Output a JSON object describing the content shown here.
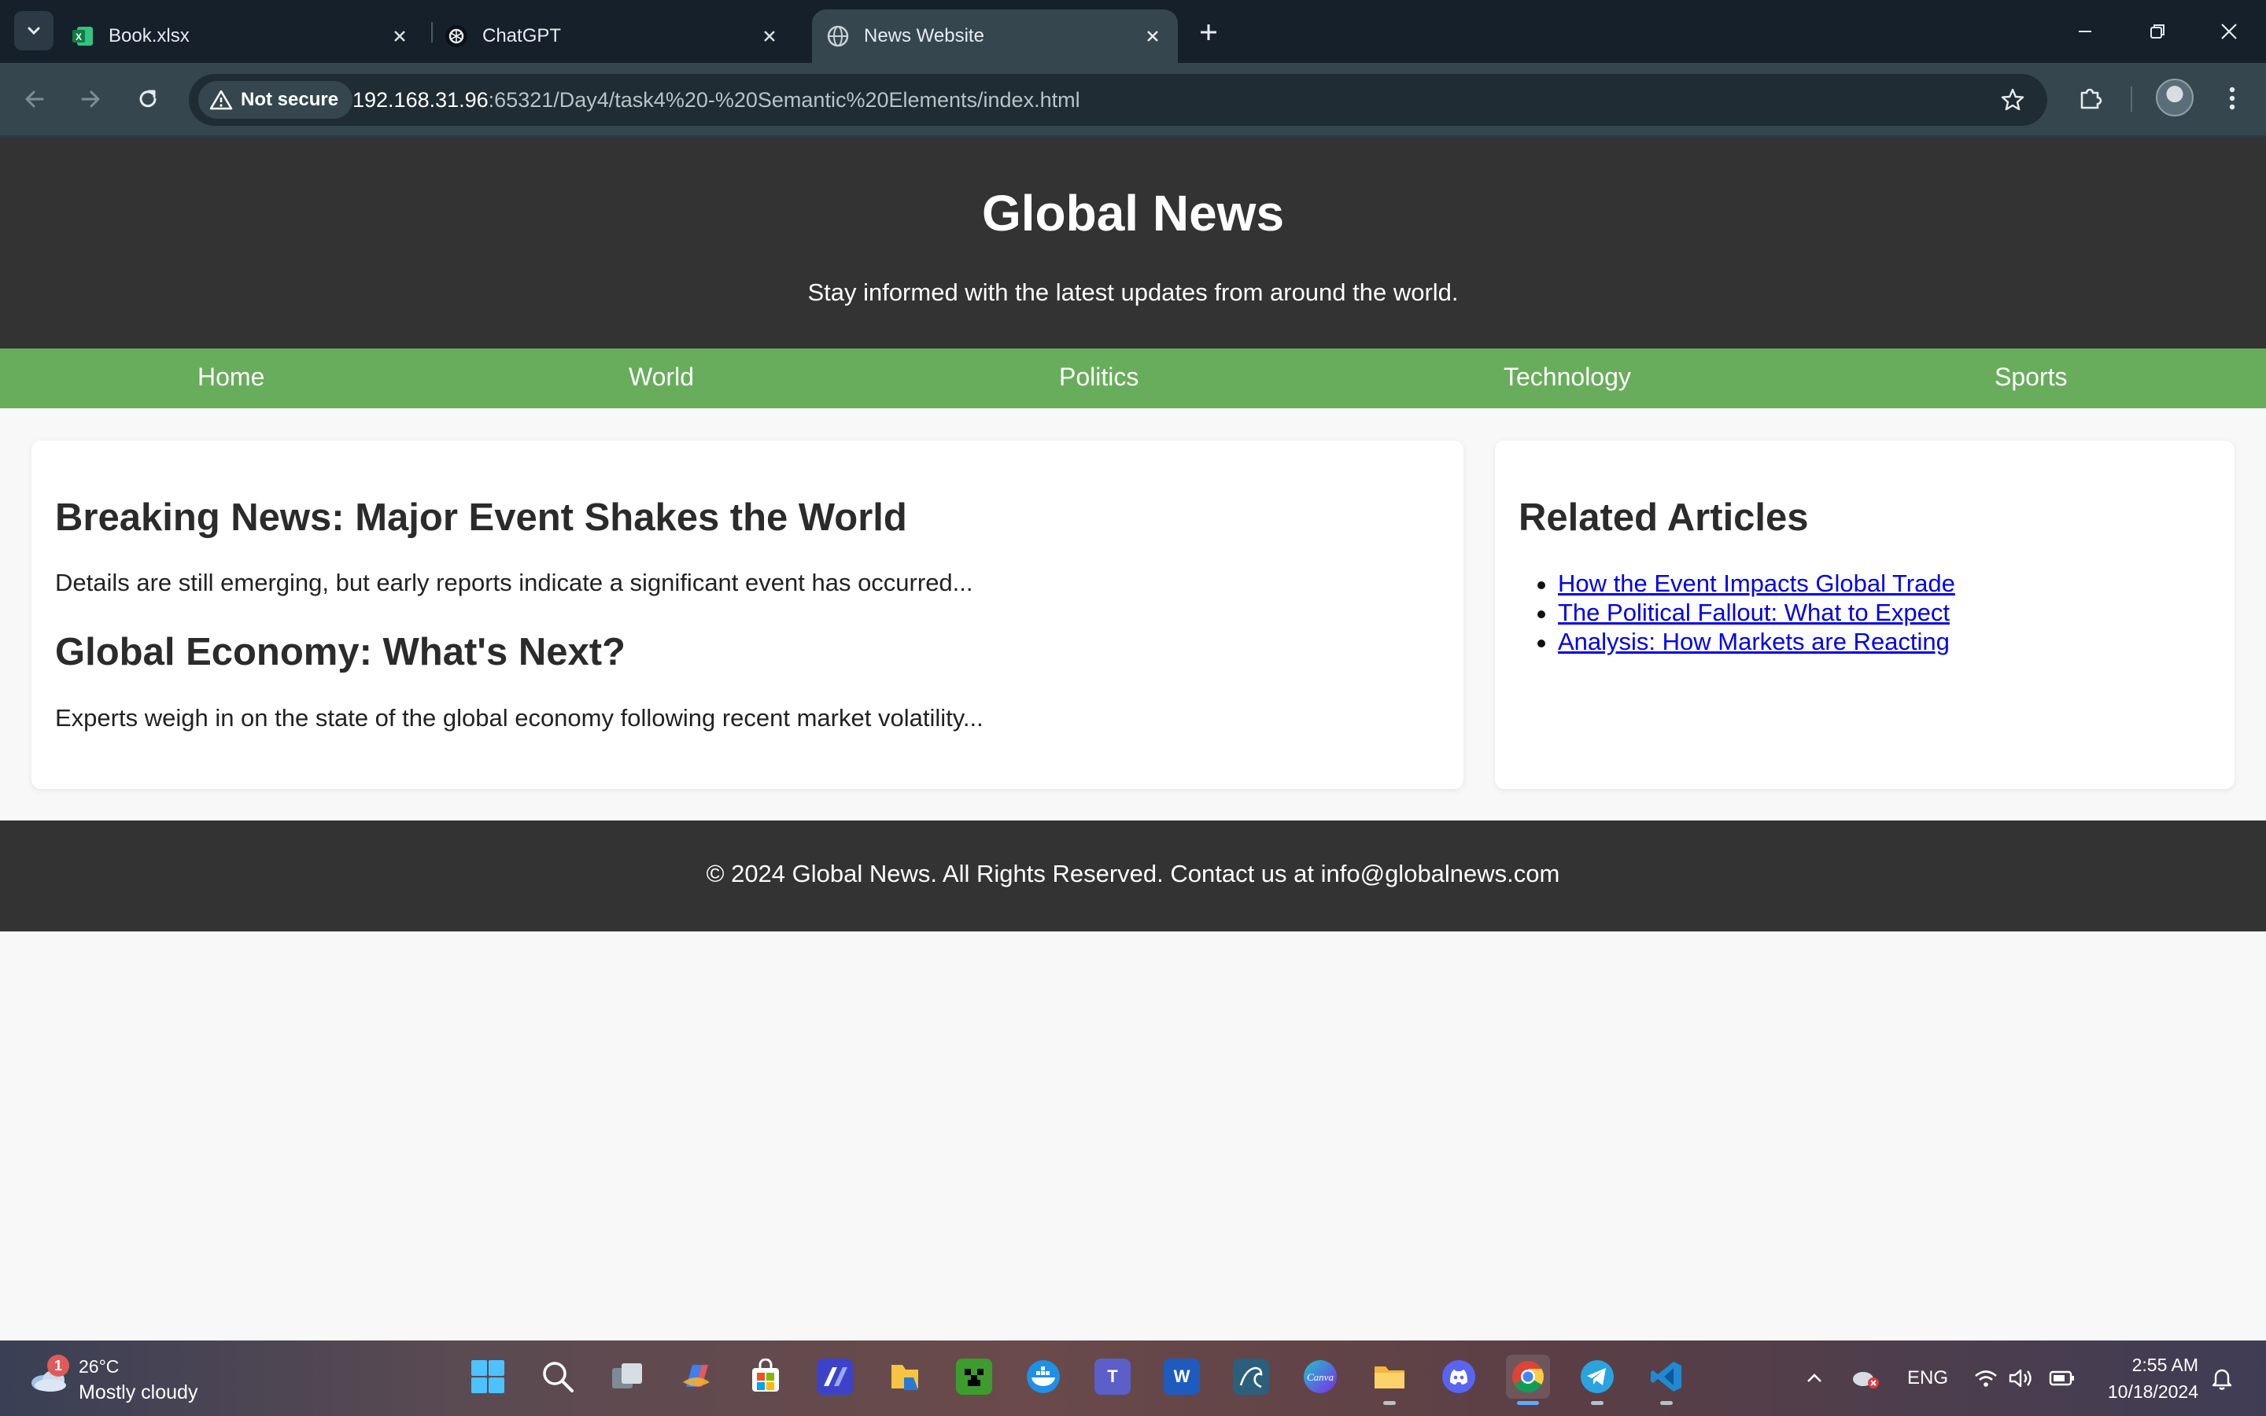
{
  "browser": {
    "tabs": [
      {
        "title": "Book.xlsx",
        "icon": "excel-icon",
        "active": false
      },
      {
        "title": "ChatGPT",
        "icon": "chatgpt-icon",
        "active": false
      },
      {
        "title": "News Website",
        "icon": "globe-icon",
        "active": true
      }
    ],
    "security_label": "Not secure",
    "url_host": "192.168.31.96",
    "url_rest": ":65321/Day4/task4%20-%20Semantic%20Elements/index.html"
  },
  "site": {
    "title": "Global News",
    "tagline": "Stay informed with the latest updates from around the world.",
    "nav": [
      "Home",
      "World",
      "Politics",
      "Technology",
      "Sports"
    ],
    "articles": [
      {
        "heading": "Breaking News: Major Event Shakes the World",
        "summary": "Details are still emerging, but early reports indicate a significant event has occurred..."
      },
      {
        "heading": "Global Economy: What's Next?",
        "summary": "Experts weigh in on the state of the global economy following recent market volatility..."
      }
    ],
    "related": {
      "heading": "Related Articles",
      "links": [
        "How the Event Impacts Global Trade",
        "The Political Fallout: What to Expect",
        "Analysis: How Markets are Reacting"
      ]
    },
    "footer": "© 2024 Global News. All Rights Reserved. Contact us at info@globalnews.com",
    "colors": {
      "header_bg": "#333333",
      "nav_bg": "#68ad5b",
      "link": "#0000ee"
    }
  },
  "taskbar": {
    "weather_badge": "1",
    "weather_temp": "26°C",
    "weather_desc": "Mostly cloudy",
    "apps": [
      "start-icon",
      "search-icon",
      "task-view-icon",
      "copilot-icon",
      "store-icon",
      "app-icon",
      "file-explorer-icon",
      "minecraft-icon",
      "docker-icon",
      "teams-icon",
      "word-icon",
      "mysql-icon",
      "canva-icon",
      "folder-icon",
      "discord-icon",
      "chrome-icon",
      "telegram-icon",
      "vscode-icon"
    ],
    "language": "ENG",
    "time": "2:55 AM",
    "date": "10/18/2024"
  }
}
